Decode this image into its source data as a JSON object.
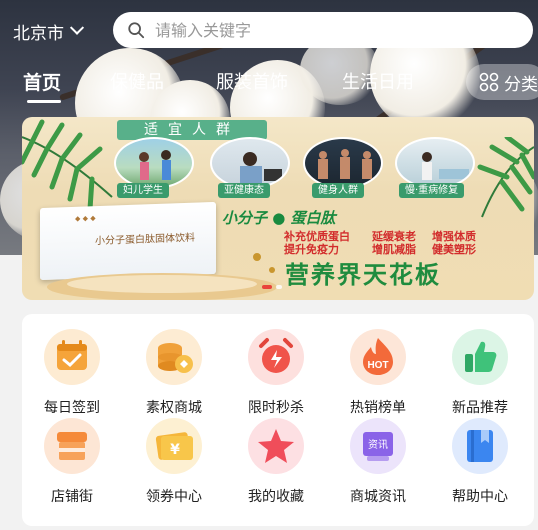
{
  "header": {
    "city": "北京市",
    "search_placeholder": "请输入关键字"
  },
  "tabs": [
    {
      "label": "首页",
      "active": true
    },
    {
      "label": "保健品",
      "active": false
    },
    {
      "label": "服装首饰",
      "active": false
    },
    {
      "label": "生活日用",
      "active": false
    }
  ],
  "category_button": "分类",
  "banner": {
    "title": "适宜人群",
    "groups": [
      "妇儿学生",
      "亚健康态",
      "健身人群",
      "慢·重病修复"
    ],
    "product_name": "小分子蛋白肽",
    "benefits": [
      "补充优质蛋白",
      "延缓衰老",
      "增强体质",
      "提升免疫力",
      "增肌减脂",
      "健美塑形"
    ],
    "slogan": "营养界天花板",
    "box_text": "小分子蛋白肽固体饮料",
    "page_indicator": {
      "count": 2,
      "active_index": 0
    }
  },
  "shortcuts": [
    {
      "label": "每日签到",
      "icon": "calendar-check-icon",
      "color": "#f5a43a"
    },
    {
      "label": "素权商城",
      "icon": "coins-stack-icon",
      "color": "#f0a13a"
    },
    {
      "label": "限时秒杀",
      "icon": "alarm-clock-icon",
      "color": "#f0544a"
    },
    {
      "label": "热销榜单",
      "icon": "hot-flame-icon",
      "color": "#f36a3a"
    },
    {
      "label": "新品推荐",
      "icon": "thumbs-up-icon",
      "color": "#3fc27a"
    },
    {
      "label": "店铺街",
      "icon": "shop-icon",
      "color": "#f58a3a"
    },
    {
      "label": "领券中心",
      "icon": "coupon-icon",
      "color": "#f5b63a"
    },
    {
      "label": "我的收藏",
      "icon": "star-icon",
      "color": "#f04d5a"
    },
    {
      "label": "商城资讯",
      "icon": "news-icon",
      "color": "#8a63e8"
    },
    {
      "label": "帮助中心",
      "icon": "help-book-icon",
      "color": "#3b86f0"
    }
  ]
}
